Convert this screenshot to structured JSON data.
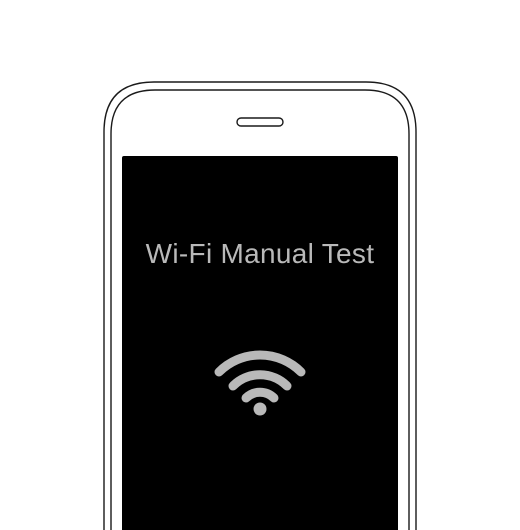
{
  "screen": {
    "title": "Wi-Fi Manual Test"
  },
  "icons": {
    "status": "wifi-icon",
    "earpiece": "speaker-slot-icon"
  },
  "colors": {
    "screen_background": "#000000",
    "foreground": "#b9b9b9",
    "device_outline": "#1a1a1a"
  }
}
